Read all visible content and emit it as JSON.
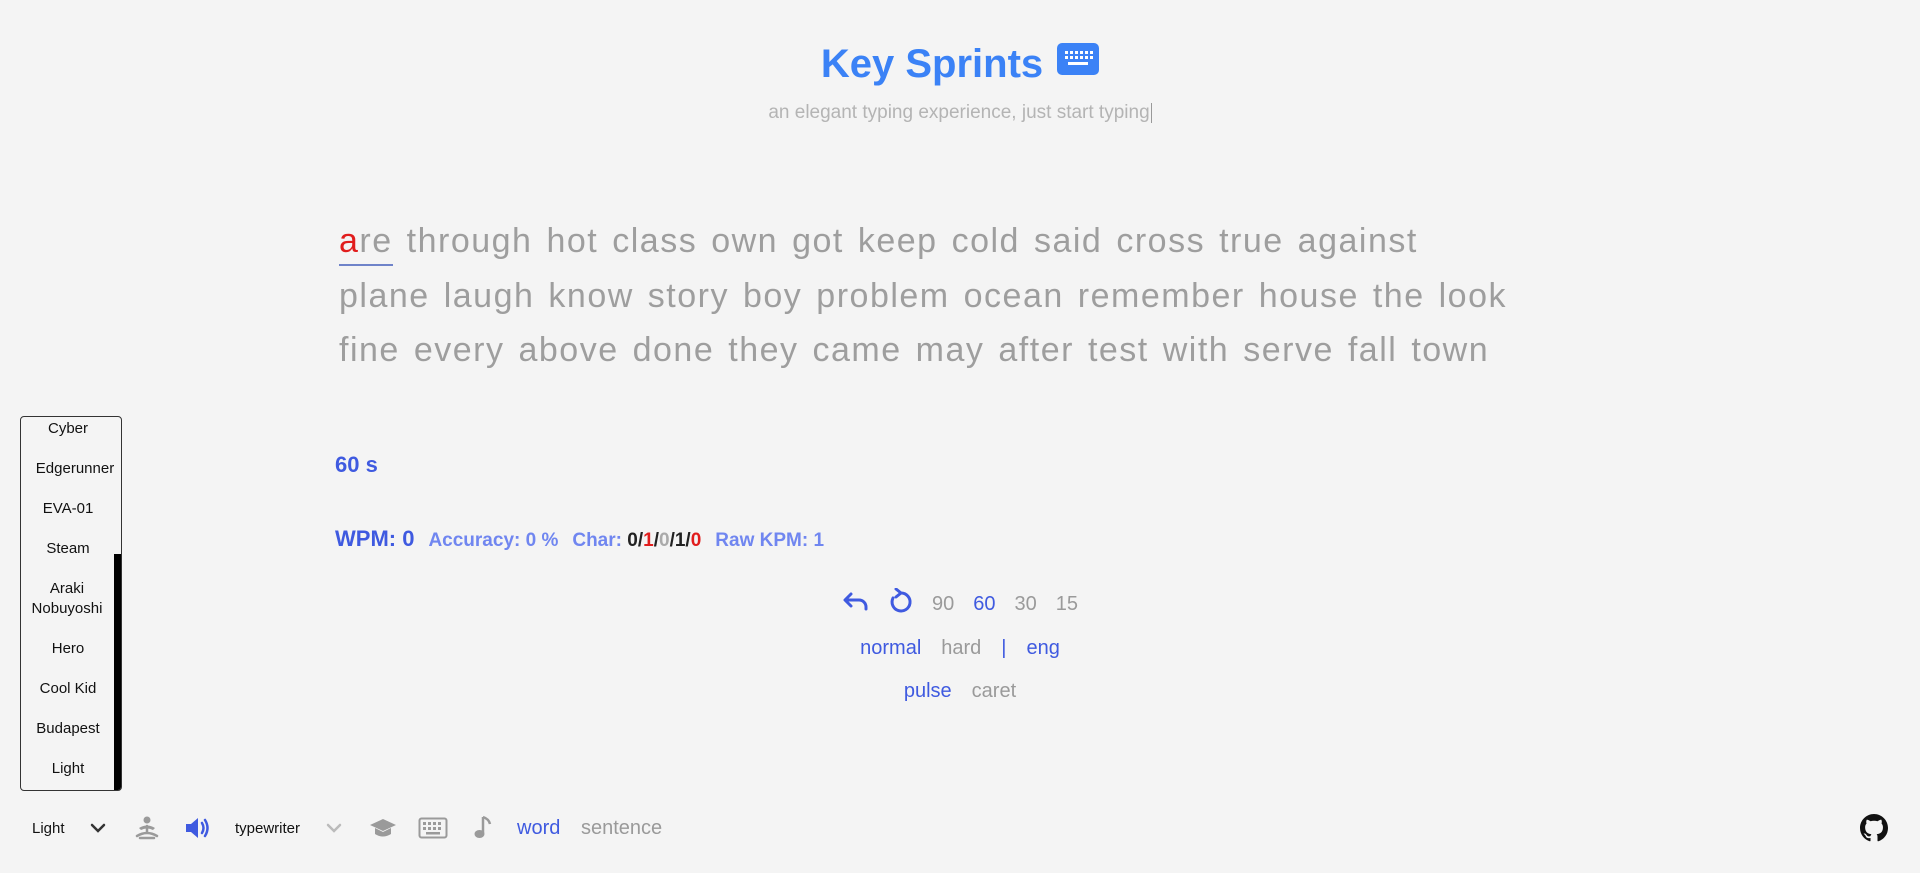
{
  "header": {
    "title": "Key Sprints",
    "subtitle": "an elegant typing experience, just start typing",
    "logo_icon": "keyboard-icon"
  },
  "words": {
    "current_first_char": "a",
    "current_rest": "re",
    "lines": [
      [
        "through",
        "hot",
        "class",
        "own",
        "got",
        "keep",
        "cold",
        "said",
        "cross",
        "true",
        "against"
      ],
      [
        "plane",
        "laugh",
        "know",
        "story",
        "boy",
        "problem",
        "ocean",
        "remember",
        "house",
        "the",
        "look"
      ],
      [
        "fine",
        "every",
        "above",
        "done",
        "they",
        "came",
        "may",
        "after",
        "test",
        "with",
        "serve",
        "fall",
        "town"
      ]
    ]
  },
  "timer": "60 s",
  "stats": {
    "wpm": "WPM: 0",
    "accuracy": "Accuracy: 0 %",
    "char_label": "Char: ",
    "char_correct": "0",
    "char_wrong": "1",
    "char_missing": "0",
    "char_extra": "1",
    "char_total_wrong": "0",
    "slash": "/",
    "raw_kpm": "Raw KPM: 1"
  },
  "controls": {
    "durations": [
      "90",
      "60",
      "30",
      "15"
    ],
    "selected_duration": "60",
    "difficulty": [
      "normal",
      "hard"
    ],
    "divider": "|",
    "language": "eng",
    "caret_styles": [
      "pulse",
      "caret"
    ]
  },
  "theme_list": [
    "Cyber",
    "Edgerunner",
    "EVA-01",
    "Steam",
    "Araki Nobuyoshi",
    "Hero",
    "Cool Kid",
    "Budapest",
    "Light"
  ],
  "bottom_bar": {
    "theme_selected": "Light",
    "sound_selected": "typewriter",
    "modes": [
      "word",
      "sentence"
    ]
  },
  "colors": {
    "accent": "#3f5ae0",
    "title": "#3b82f6",
    "error": "#e11d1d",
    "muted": "#9e9e9e",
    "background": "#f4f4f4"
  }
}
